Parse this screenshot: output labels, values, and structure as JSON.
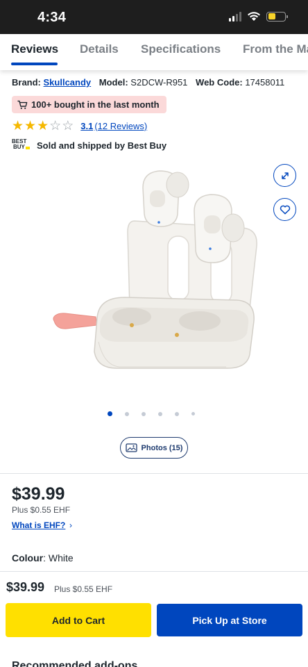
{
  "status_bar": {
    "time": "4:34",
    "icons": [
      "signal-icon",
      "wifi-icon",
      "battery-icon"
    ]
  },
  "tabs": [
    "Reviews",
    "Details",
    "Specifications",
    "From the Ma"
  ],
  "product_meta": {
    "brand_label": "Brand:",
    "brand_value": "Skullcandy",
    "model_label": "Model:",
    "model_value": "S2DCW-R951",
    "webcode_label": "Web Code:",
    "webcode_value": "17458011"
  },
  "badge": {
    "icon": "cart-icon",
    "text": "100+ bought in the last month"
  },
  "rating": {
    "stars_filled": 3,
    "stars_total": 5,
    "value": "3.1",
    "reviews": "(12 Reviews)"
  },
  "seller": {
    "logo_line1": "BEST",
    "logo_line2": "BUY",
    "text": "Sold and shipped by Best Buy"
  },
  "gallery": {
    "image_alt": "Skullcandy Dime true wireless earbuds in open charging case, white",
    "image_count": 6,
    "active_index": 0,
    "expand_icon": "expand-icon",
    "wishlist_icon": "heart-icon",
    "photos_label": "Photos (15)"
  },
  "pricing": {
    "price": "$39.99",
    "ehf": "Plus $0.55 EHF",
    "ehf_link": "What is EHF?"
  },
  "colour": {
    "label": "Colour",
    "value": "White"
  },
  "sticky_bar": {
    "price": "$39.99",
    "ehf": "Plus $0.55 EHF",
    "add_to_cart": "Add to Cart",
    "pickup": "Pick Up at Store"
  },
  "recommended_heading": "Recommended add-ons",
  "colors": {
    "brand_blue": "#0046be",
    "brand_yellow": "#ffe000",
    "star": "#f5b800",
    "badge_bg": "#fbd9d9"
  }
}
